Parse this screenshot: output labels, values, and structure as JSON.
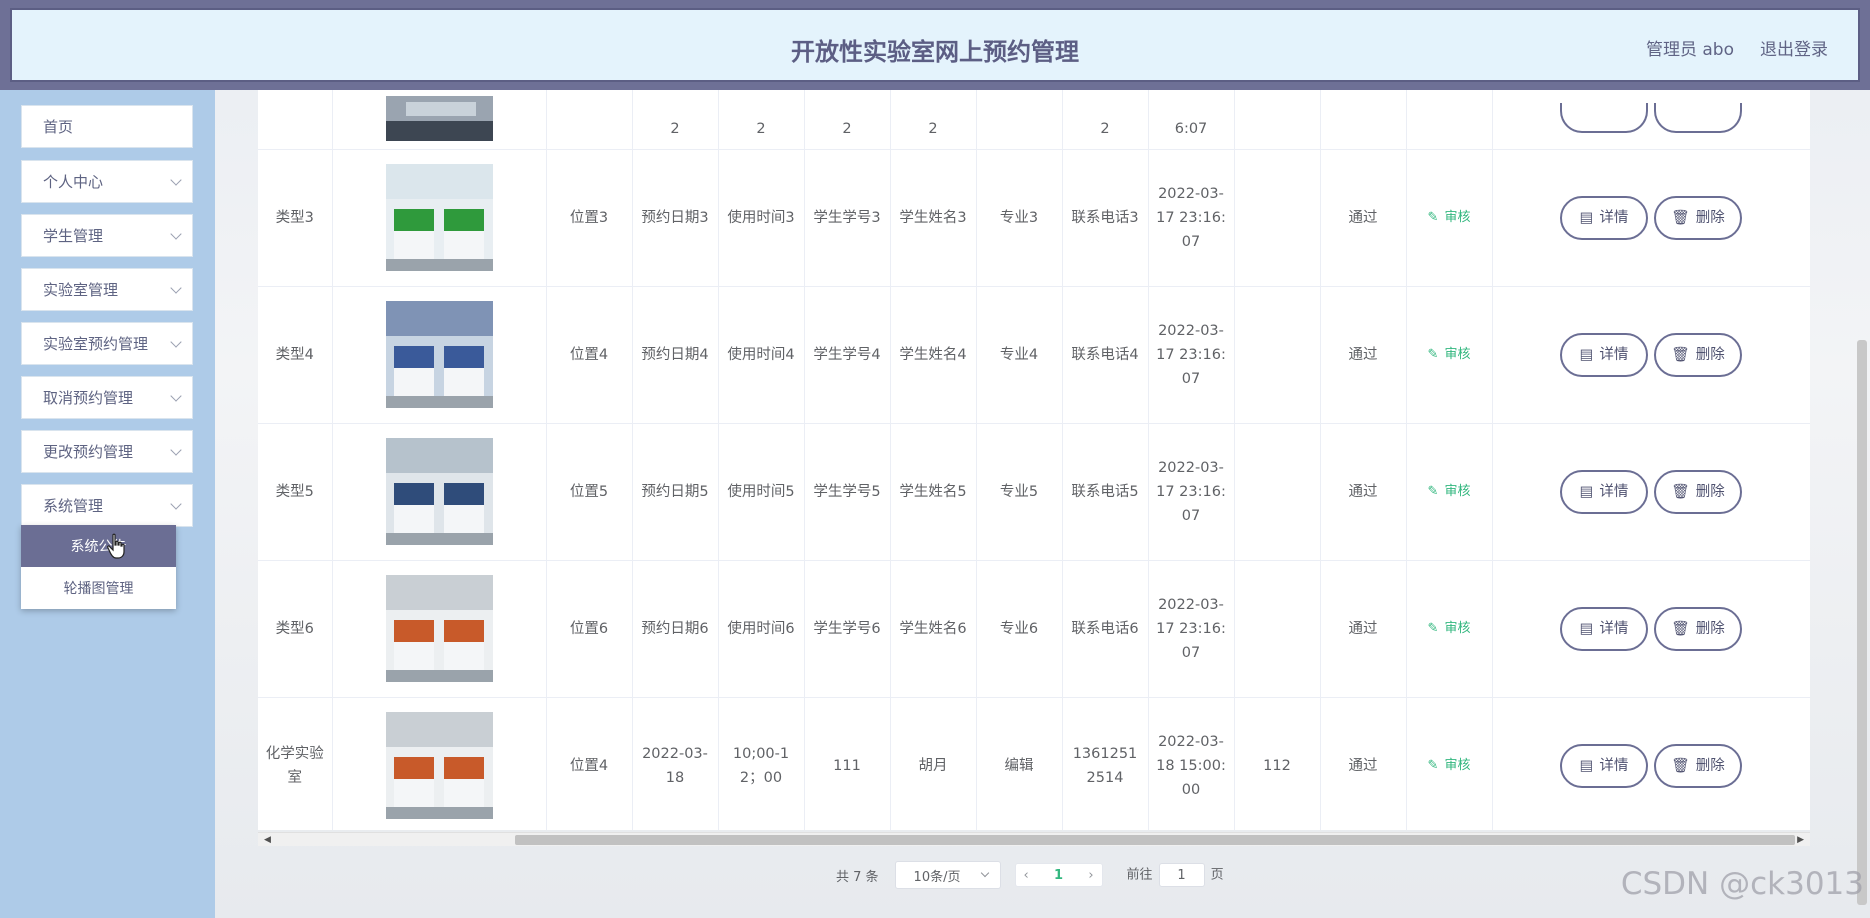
{
  "header": {
    "title": "开放性实验室网上预约管理",
    "user": "管理员 abo",
    "logout": "退出登录"
  },
  "sidebar": {
    "items": [
      {
        "label": "首页"
      },
      {
        "label": "个人中心"
      },
      {
        "label": "学生管理"
      },
      {
        "label": "实验室管理"
      },
      {
        "label": "实验室预约管理"
      },
      {
        "label": "取消预约管理"
      },
      {
        "label": "更改预约管理"
      },
      {
        "label": "系统管理"
      }
    ],
    "submenu": [
      {
        "label": "系统公告"
      },
      {
        "label": "轮播图管理"
      }
    ]
  },
  "table": {
    "partial_row": {
      "c3": "2",
      "c4": "2",
      "c5": "2",
      "c6": "2",
      "c8": "2",
      "c9": "6:07"
    },
    "rows": [
      {
        "type": "类型3",
        "loc": "位置3",
        "date": "预约日期3",
        "time": "使用时间3",
        "sid": "学生学号3",
        "name": "学生姓名3",
        "major": "专业3",
        "phone": "联系电话3",
        "created": "2022-03-17 23:16:07",
        "reply": "",
        "status": "通过"
      },
      {
        "type": "类型4",
        "loc": "位置4",
        "date": "预约日期4",
        "time": "使用时间4",
        "sid": "学生学号4",
        "name": "学生姓名4",
        "major": "专业4",
        "phone": "联系电话4",
        "created": "2022-03-17 23:16:07",
        "reply": "",
        "status": "通过"
      },
      {
        "type": "类型5",
        "loc": "位置5",
        "date": "预约日期5",
        "time": "使用时间5",
        "sid": "学生学号5",
        "name": "学生姓名5",
        "major": "专业5",
        "phone": "联系电话5",
        "created": "2022-03-17 23:16:07",
        "reply": "",
        "status": "通过"
      },
      {
        "type": "类型6",
        "loc": "位置6",
        "date": "预约日期6",
        "time": "使用时间6",
        "sid": "学生学号6",
        "name": "学生姓名6",
        "major": "专业6",
        "phone": "联系电话6",
        "created": "2022-03-17 23:16:07",
        "reply": "",
        "status": "通过"
      },
      {
        "type": "化学实验室",
        "loc": "位置4",
        "date": "2022-03-18",
        "time": "10;00-12；00",
        "sid": "111",
        "name": "胡月",
        "major": "编辑",
        "phone": "13612512514",
        "created": "2022-03-18 15:00:00",
        "reply": "112",
        "status": "通过"
      }
    ],
    "audit_label": "审核",
    "detail_label": "详情",
    "delete_label": "删除"
  },
  "pagination": {
    "total": "共 7 条",
    "page_size": "10条/页",
    "current": "1",
    "goto_label": "前往",
    "goto_value": "1",
    "page_suffix": "页"
  },
  "watermark": "CSDN @ck3013"
}
